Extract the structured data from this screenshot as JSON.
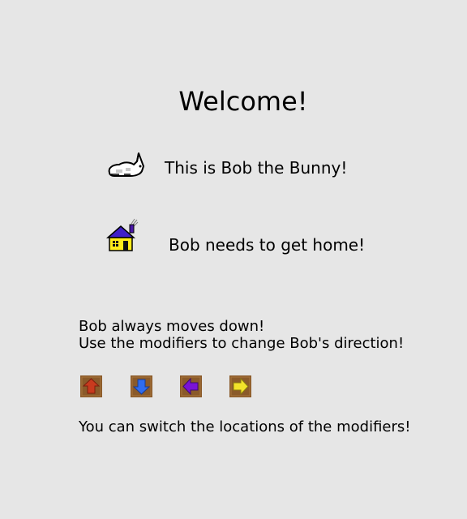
{
  "title": "Welcome!",
  "bob": {
    "icon": "bunny-icon",
    "text": "This is Bob the Bunny!"
  },
  "home": {
    "icon": "house-icon",
    "text": "Bob needs to get home!"
  },
  "instructions": {
    "line1": "Bob always moves down!",
    "line2": "Use the modifiers to change Bob's direction!"
  },
  "modifiers": [
    {
      "icon": "arrow-up-icon",
      "color": "#c83a1e"
    },
    {
      "icon": "arrow-down-icon",
      "color": "#2f6cf0"
    },
    {
      "icon": "arrow-left-icon",
      "color": "#7a13d6"
    },
    {
      "icon": "arrow-right-icon",
      "color": "#f2e22a"
    }
  ],
  "tile_color": "#8a5a2a",
  "footer": "You can switch the locations of the modifiers!"
}
